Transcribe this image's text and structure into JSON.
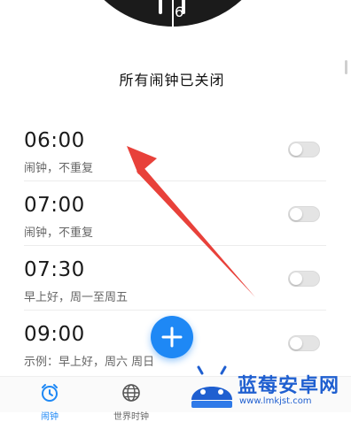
{
  "clock": {
    "numeral_6": "6"
  },
  "status_title": "所有闹钟已关闭",
  "alarms": [
    {
      "time": "06:00",
      "desc": "闹钟，不重复",
      "enabled": false
    },
    {
      "time": "07:00",
      "desc": "闹钟，不重复",
      "enabled": false
    },
    {
      "time": "07:30",
      "desc": "早上好，周一至周五",
      "enabled": false
    },
    {
      "time": "09:00",
      "desc": "示例：早上好，周六 周日",
      "enabled": false
    }
  ],
  "nav": {
    "alarm_label": "闹钟",
    "world_clock_label": "世界时钟"
  },
  "watermark": {
    "title": "蓝莓安卓网",
    "url": "www.lmkjst.com"
  },
  "colors": {
    "accent": "#1e88f5",
    "arrow": "#e8413a",
    "toggle_off": "#e4e4e4"
  },
  "icons": {
    "fab": "plus-icon",
    "nav_alarm": "alarm-clock-icon",
    "nav_world": "globe-icon",
    "annotation": "red-arrow-icon"
  }
}
